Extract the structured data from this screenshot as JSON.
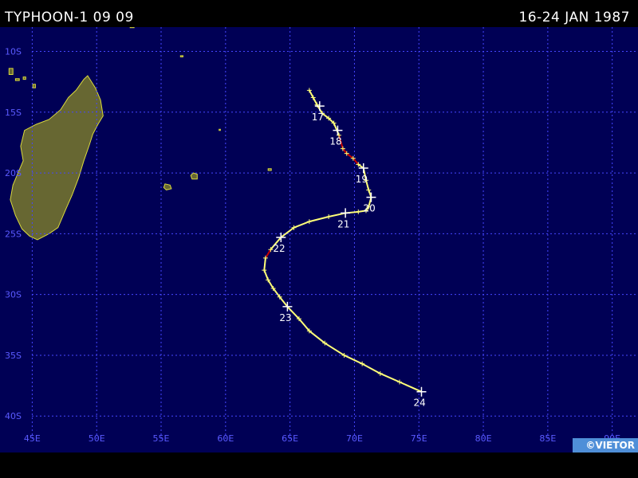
{
  "header": {
    "title": "TYPHOON-1 09 09",
    "date_range": "16-24 JAN 1987"
  },
  "copyright": "©VIETOR",
  "map": {
    "lon_range": [
      42.5,
      92
    ],
    "lat_range": [
      -43,
      -8
    ],
    "lon_labels": [
      "45E",
      "50E",
      "55E",
      "60E",
      "65E",
      "70E",
      "75E",
      "80E",
      "85E",
      "90E"
    ],
    "lon_values": [
      45,
      50,
      55,
      60,
      65,
      70,
      75,
      80,
      85,
      90
    ],
    "lat_labels": [
      "10S",
      "15S",
      "20S",
      "25S",
      "30S",
      "35S",
      "40S"
    ],
    "lat_values": [
      -10,
      -15,
      -20,
      -25,
      -30,
      -35,
      -40
    ],
    "colors": {
      "ocean": "#000055",
      "grid": "#4646ff",
      "land": "#676732",
      "land_outline": "#dada3c",
      "track_default": "#ffff78",
      "track_intense": "#c80000",
      "marker": "#ffffff",
      "label": "#ffffff",
      "axis_label": "#5a5aff"
    },
    "track": [
      {
        "lon": 66.5,
        "lat": -13.2
      },
      {
        "lon": 66.8,
        "lat": -13.8
      },
      {
        "lon": 67.1,
        "lat": -14.4
      },
      {
        "lon": 67.5,
        "lat": -15.1
      },
      {
        "lon": 68.0,
        "lat": -15.5
      },
      {
        "lon": 68.4,
        "lat": -15.9
      },
      {
        "lon": 68.8,
        "lat": -16.9
      },
      {
        "lon": 69.1,
        "lat": -18.0
      },
      {
        "lon": 69.4,
        "lat": -18.4
      },
      {
        "lon": 69.9,
        "lat": -18.8
      },
      {
        "lon": 70.3,
        "lat": -19.3
      },
      {
        "lon": 70.7,
        "lat": -19.6
      },
      {
        "lon": 70.9,
        "lat": -20.6
      },
      {
        "lon": 71.1,
        "lat": -21.4
      },
      {
        "lon": 71.3,
        "lat": -22.0
      },
      {
        "lon": 71.1,
        "lat": -22.8
      },
      {
        "lon": 70.9,
        "lat": -23.1
      },
      {
        "lon": 70.3,
        "lat": -23.2
      },
      {
        "lon": 69.3,
        "lat": -23.3
      },
      {
        "lon": 68.0,
        "lat": -23.6
      },
      {
        "lon": 66.5,
        "lat": -24.0
      },
      {
        "lon": 65.3,
        "lat": -24.5
      },
      {
        "lon": 64.3,
        "lat": -25.3
      },
      {
        "lon": 63.5,
        "lat": -26.3
      },
      {
        "lon": 63.1,
        "lat": -27.0
      },
      {
        "lon": 63.0,
        "lat": -28.0
      },
      {
        "lon": 63.3,
        "lat": -28.8
      },
      {
        "lon": 63.7,
        "lat": -29.5
      },
      {
        "lon": 64.2,
        "lat": -30.2
      },
      {
        "lon": 64.8,
        "lat": -31.0
      },
      {
        "lon": 65.7,
        "lat": -32.0
      },
      {
        "lon": 66.5,
        "lat": -33.0
      },
      {
        "lon": 67.7,
        "lat": -34.0
      },
      {
        "lon": 69.2,
        "lat": -35.0
      },
      {
        "lon": 70.6,
        "lat": -35.7
      },
      {
        "lon": 72.0,
        "lat": -36.5
      },
      {
        "lon": 73.5,
        "lat": -37.2
      },
      {
        "lon": 75.2,
        "lat": -38.0
      }
    ],
    "intense_segments": [
      [
        6,
        10
      ],
      [
        23,
        24
      ]
    ],
    "day_markers": [
      {
        "label": "17",
        "lon": 67.3,
        "lat": -14.5
      },
      {
        "label": "18",
        "lon": 68.7,
        "lat": -16.5
      },
      {
        "label": "19",
        "lon": 70.7,
        "lat": -19.6
      },
      {
        "label": "20",
        "lon": 71.3,
        "lat": -22.0
      },
      {
        "label": "21",
        "lon": 69.3,
        "lat": -23.3
      },
      {
        "label": "22",
        "lon": 64.3,
        "lat": -25.3
      },
      {
        "label": "23",
        "lon": 64.8,
        "lat": -31.0
      },
      {
        "label": "24",
        "lon": 75.2,
        "lat": -38.0
      }
    ],
    "land": [
      {
        "name": "madagascar",
        "points": [
          [
            49.3,
            -12.0
          ],
          [
            49.9,
            -13.0
          ],
          [
            50.3,
            -14.0
          ],
          [
            50.5,
            -15.3
          ],
          [
            50.1,
            -16.0
          ],
          [
            49.7,
            -16.8
          ],
          [
            49.4,
            -17.8
          ],
          [
            49.0,
            -19.0
          ],
          [
            48.6,
            -20.4
          ],
          [
            48.1,
            -21.8
          ],
          [
            47.6,
            -23.0
          ],
          [
            47.0,
            -24.5
          ],
          [
            46.3,
            -25.0
          ],
          [
            45.4,
            -25.5
          ],
          [
            44.8,
            -25.2
          ],
          [
            44.2,
            -24.6
          ],
          [
            43.7,
            -23.5
          ],
          [
            43.3,
            -22.2
          ],
          [
            43.5,
            -21.0
          ],
          [
            43.9,
            -20.0
          ],
          [
            44.3,
            -19.0
          ],
          [
            44.1,
            -17.8
          ],
          [
            44.4,
            -16.5
          ],
          [
            45.3,
            -16.0
          ],
          [
            46.3,
            -15.6
          ],
          [
            47.2,
            -14.8
          ],
          [
            47.8,
            -13.8
          ],
          [
            48.4,
            -13.2
          ],
          [
            49.0,
            -12.3
          ]
        ]
      },
      {
        "name": "reunion",
        "points": [
          [
            55.3,
            -20.9
          ],
          [
            55.7,
            -21.0
          ],
          [
            55.8,
            -21.3
          ],
          [
            55.4,
            -21.4
          ],
          [
            55.2,
            -21.2
          ]
        ]
      },
      {
        "name": "mauritius",
        "points": [
          [
            57.5,
            -20.0
          ],
          [
            57.8,
            -20.1
          ],
          [
            57.8,
            -20.5
          ],
          [
            57.4,
            -20.5
          ],
          [
            57.3,
            -20.2
          ]
        ]
      },
      {
        "name": "rodrigues",
        "points": [
          [
            63.3,
            -19.65
          ],
          [
            63.55,
            -19.65
          ],
          [
            63.55,
            -19.8
          ],
          [
            63.3,
            -19.8
          ]
        ]
      },
      {
        "name": "comoros-ngazidja",
        "points": [
          [
            43.2,
            -11.4
          ],
          [
            43.5,
            -11.4
          ],
          [
            43.5,
            -11.9
          ],
          [
            43.2,
            -11.9
          ]
        ]
      },
      {
        "name": "comoros-mwali",
        "points": [
          [
            43.7,
            -12.25
          ],
          [
            44.0,
            -12.25
          ],
          [
            44.0,
            -12.4
          ],
          [
            43.7,
            -12.4
          ]
        ]
      },
      {
        "name": "comoros-nzwani",
        "points": [
          [
            44.3,
            -12.1
          ],
          [
            44.5,
            -12.1
          ],
          [
            44.5,
            -12.3
          ],
          [
            44.3,
            -12.3
          ]
        ]
      },
      {
        "name": "mayotte",
        "points": [
          [
            45.05,
            -12.7
          ],
          [
            45.25,
            -12.7
          ],
          [
            45.25,
            -13.0
          ],
          [
            45.05,
            -13.0
          ]
        ]
      },
      {
        "name": "seychelles-alphonse",
        "points": [
          [
            52.6,
            -7.9
          ],
          [
            52.9,
            -7.9
          ],
          [
            52.9,
            -8.05
          ],
          [
            52.6,
            -8.05
          ]
        ]
      },
      {
        "name": "agalega",
        "points": [
          [
            56.5,
            -10.35
          ],
          [
            56.7,
            -10.35
          ],
          [
            56.7,
            -10.45
          ],
          [
            56.5,
            -10.45
          ]
        ]
      },
      {
        "name": "cargados",
        "points": [
          [
            59.5,
            -16.4
          ],
          [
            59.6,
            -16.4
          ],
          [
            59.6,
            -16.5
          ],
          [
            59.5,
            -16.5
          ]
        ]
      }
    ]
  }
}
